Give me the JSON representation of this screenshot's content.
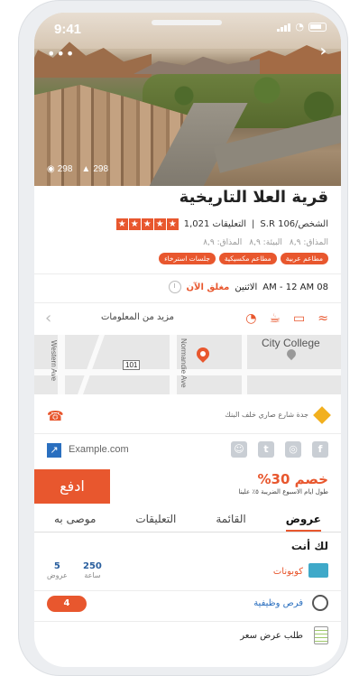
{
  "status": {
    "time": "9:41"
  },
  "hero": {
    "views": "298",
    "photos": "298"
  },
  "place": {
    "title": "قرية العلا التاريخية",
    "reviews": "التعليقات 1,021",
    "price": "الشخص/S.R 106",
    "scores": [
      "المذاق: ٨,٩",
      "البيئة: ٨,٩",
      "المذاق: ٨,٩"
    ],
    "tags": [
      "مطاعم عربية",
      "مطاعم مكسيكية",
      "جلسات استرخاء"
    ]
  },
  "hours": {
    "closed": "مغلق الآن",
    "day": "الاثنين",
    "range": "08 AM - 12 AM"
  },
  "amenities": {
    "more": "مزيد من المعلومات"
  },
  "map": {
    "city": "City College",
    "street1": "Western Ave",
    "street2": "Normandie Ave",
    "route": "101"
  },
  "contact": {
    "address": "جدة شارع صاري خلف البنك",
    "website": "Example.com"
  },
  "deal": {
    "pay": "ادفع",
    "percent": "خصم 30%",
    "note": "طول ايام الاسبوع الضريبة ٥٪ علينا"
  },
  "tabs": [
    "عروض",
    "القائمة",
    "التعليقات",
    "موصى به"
  ],
  "foryou": {
    "title": "لك أنت",
    "coupons": "كوبونات",
    "offers_count": "5",
    "offers_label": "عروض",
    "hours_count": "250",
    "hours_label": "ساعة",
    "jobs": "فرص وظيفية",
    "jobs_badge": "4",
    "quote": "طلب عرض سعر"
  }
}
